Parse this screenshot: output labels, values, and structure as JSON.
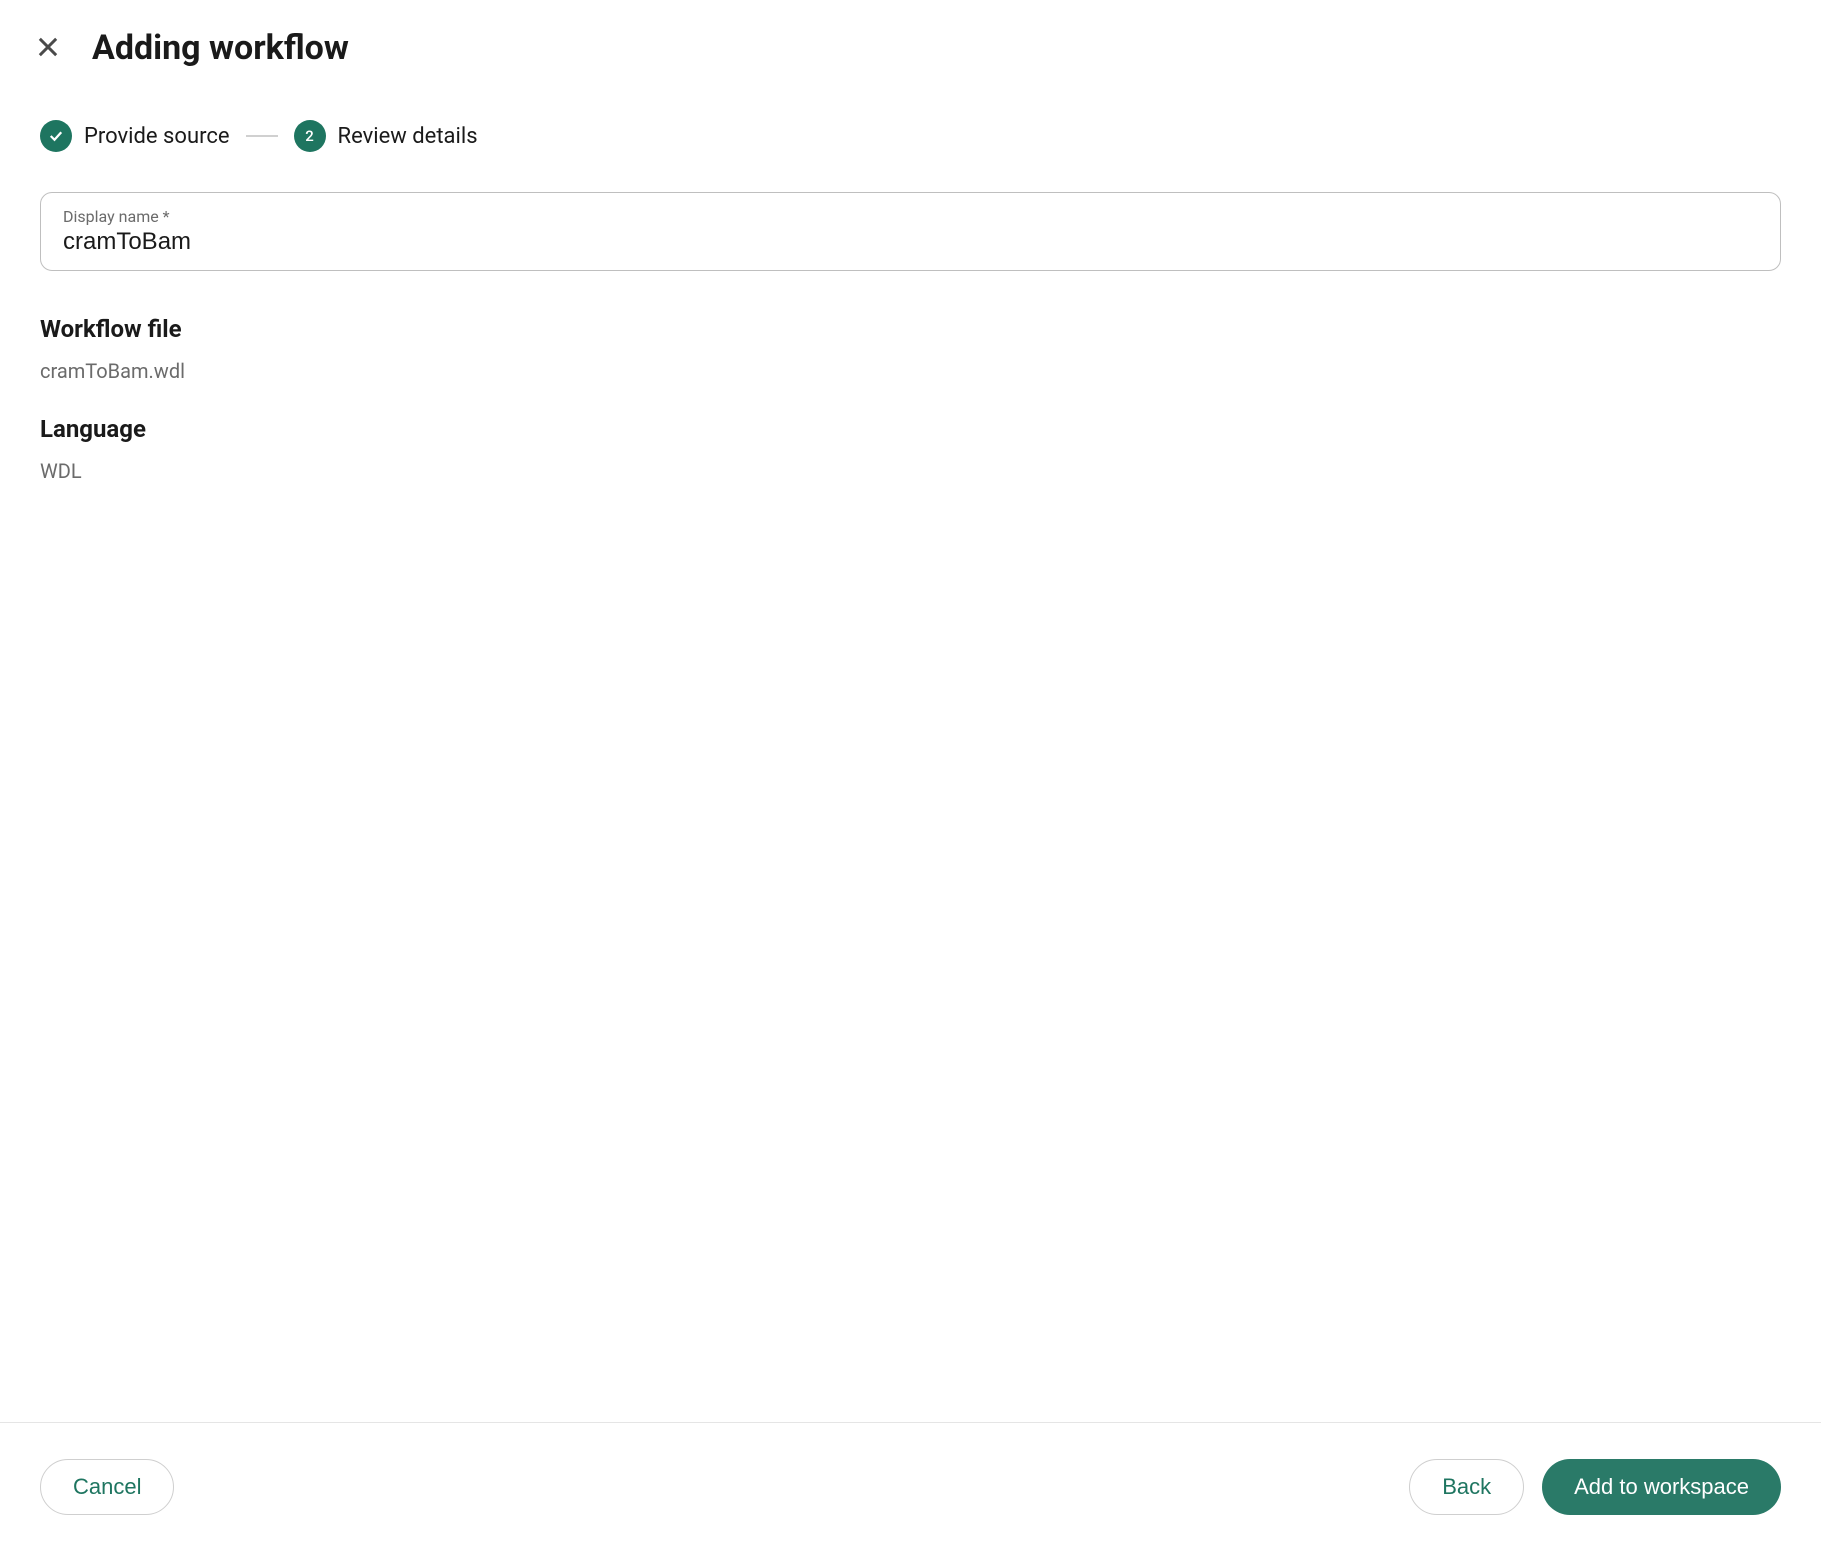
{
  "header": {
    "title": "Adding workflow"
  },
  "stepper": {
    "steps": [
      {
        "label": "Provide source",
        "completed": true
      },
      {
        "label": "Review details",
        "number": "2",
        "active": true
      }
    ]
  },
  "form": {
    "display_name": {
      "label": "Display name *",
      "value": "cramToBam"
    },
    "workflow_file": {
      "label": "Workflow file",
      "value": "cramToBam.wdl"
    },
    "language": {
      "label": "Language",
      "value": "WDL"
    }
  },
  "footer": {
    "cancel_label": "Cancel",
    "back_label": "Back",
    "submit_label": "Add to workspace"
  }
}
